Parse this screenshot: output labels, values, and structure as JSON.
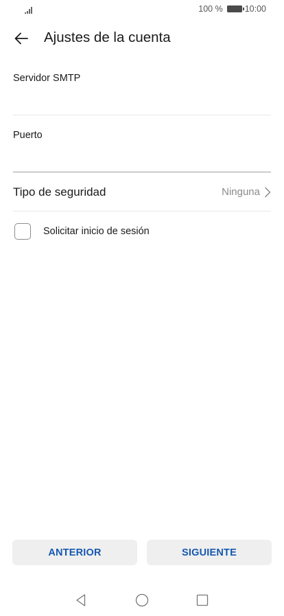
{
  "status_bar": {
    "battery_percent": "100 %",
    "time": "10:00"
  },
  "header": {
    "title": "Ajustes de la cuenta"
  },
  "form": {
    "smtp_label": "Servidor SMTP",
    "smtp_value": "",
    "port_label": "Puerto",
    "port_value": "",
    "security_label": "Tipo de seguridad",
    "security_value": "Ninguna",
    "signin_label": "Solicitar inicio de sesión",
    "signin_checked": false
  },
  "buttons": {
    "previous": "ANTERIOR",
    "next": "SIGUIENTE"
  },
  "colors": {
    "accent": "#1558b0",
    "button_bg": "#efefef",
    "divider": "#e8e8e8"
  },
  "icons": [
    "signal-icon",
    "battery-icon",
    "back-arrow-icon",
    "chevron-right-icon",
    "nav-back-icon",
    "nav-home-icon",
    "nav-recents-icon"
  ]
}
